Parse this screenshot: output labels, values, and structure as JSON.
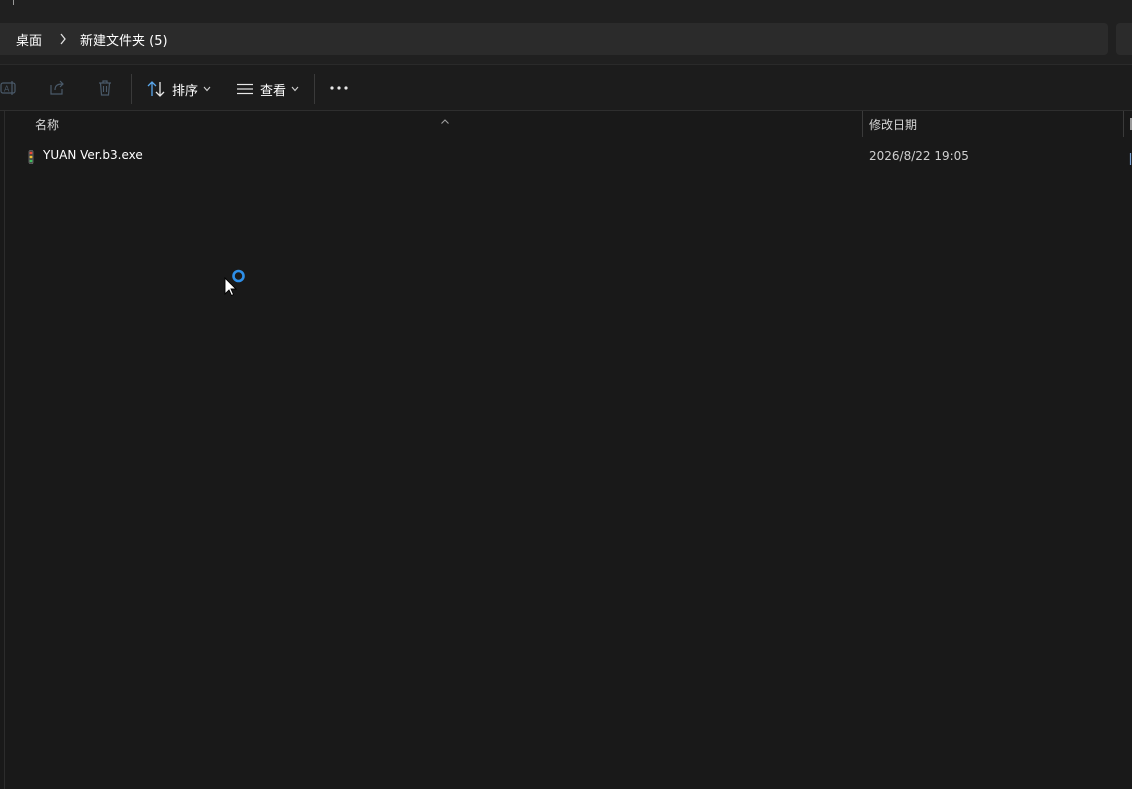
{
  "breadcrumb": {
    "items": [
      "桌面",
      "新建文件夹 (5)"
    ]
  },
  "toolbar": {
    "sort_label": "排序",
    "view_label": "查看",
    "icons": [
      "rename-icon",
      "share-icon",
      "delete-icon",
      "sort-icon",
      "view-lines-icon",
      "more-icon"
    ]
  },
  "columns": {
    "name": "名称",
    "date": "修改日期"
  },
  "files": [
    {
      "name": "YUAN Ver.b3.exe",
      "modified": "2026/8/22 19:05",
      "icon": "exe-file-icon"
    }
  ],
  "colors": {
    "background": "#191919",
    "accent": "#2e8fe8",
    "toolbar": "#1c1c1c"
  }
}
